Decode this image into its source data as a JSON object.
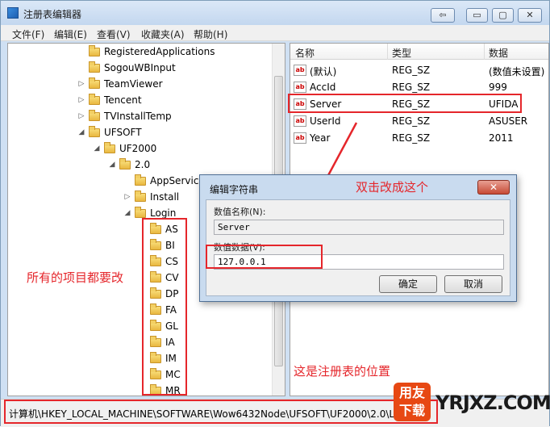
{
  "window": {
    "title": "注册表编辑器",
    "buttons": {
      "back": "⇦",
      "minimize": "▭",
      "maximize": "▢",
      "close": "✕"
    }
  },
  "menu": [
    "文件(F)",
    "编辑(E)",
    "查看(V)",
    "收藏夹(A)",
    "帮助(H)"
  ],
  "tree": [
    {
      "label": "RegisteredApplications",
      "expander": ""
    },
    {
      "label": "SogouWBInput",
      "expander": ""
    },
    {
      "label": "TeamViewer",
      "expander": "▷"
    },
    {
      "label": "Tencent",
      "expander": "▷"
    },
    {
      "label": "TVInstallTemp",
      "expander": "▷"
    },
    {
      "label": "UFSOFT",
      "expander": "◢"
    },
    {
      "label": "UF2000",
      "expander": "◢"
    },
    {
      "label": "2.0",
      "expander": "◢"
    },
    {
      "label": "AppService",
      "expander": ""
    },
    {
      "label": "Install",
      "expander": "▷"
    },
    {
      "label": "Login",
      "expander": "◢"
    },
    {
      "label": "AS",
      "expander": ""
    },
    {
      "label": "BI",
      "expander": ""
    },
    {
      "label": "CS",
      "expander": ""
    },
    {
      "label": "CV",
      "expander": ""
    },
    {
      "label": "DP",
      "expander": ""
    },
    {
      "label": "FA",
      "expander": ""
    },
    {
      "label": "GL",
      "expander": ""
    },
    {
      "label": "IA",
      "expander": ""
    },
    {
      "label": "IM",
      "expander": ""
    },
    {
      "label": "MC",
      "expander": ""
    },
    {
      "label": "MR",
      "expander": ""
    }
  ],
  "values": {
    "headers": [
      "名称",
      "类型",
      "数据"
    ],
    "rows": [
      {
        "name": "(默认)",
        "type": "REG_SZ",
        "data": "(数值未设置)"
      },
      {
        "name": "AccId",
        "type": "REG_SZ",
        "data": "999"
      },
      {
        "name": "Server",
        "type": "REG_SZ",
        "data": "UFIDA"
      },
      {
        "name": "UserId",
        "type": "REG_SZ",
        "data": "ASUSER"
      },
      {
        "name": "Year",
        "type": "REG_SZ",
        "data": "2011"
      }
    ],
    "icon": "ab"
  },
  "dialog": {
    "title": "编辑字符串",
    "close_label": "✕",
    "name_label": "数值名称(N):",
    "name_value": "Server",
    "data_label": "数值数据(V):",
    "data_value": "127.0.0.1",
    "ok_label": "确定",
    "cancel_label": "取消"
  },
  "status_path": "计算机\\HKEY_LOCAL_MACHINE\\SOFTWARE\\Wow6432Node\\UFSOFT\\UF2000\\2.0\\L",
  "annotations": {
    "double_click": "双击改成这个",
    "all_items": "所有的项目都要改",
    "registry_location": "这是注册表的位置"
  },
  "watermark": {
    "badge_line1": "用友",
    "badge_line2": "下载",
    "text": "YRJXZ.COM"
  },
  "colors": {
    "annotation": "#e5262b",
    "watermark_badge": "#e74813"
  }
}
